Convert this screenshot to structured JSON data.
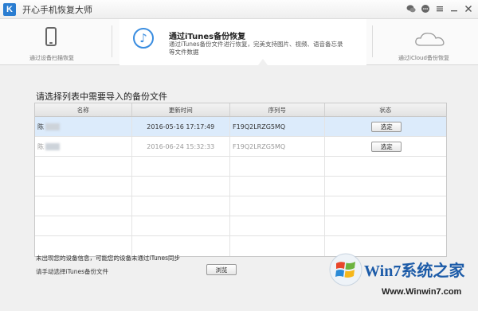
{
  "app": {
    "logo_letter": "K",
    "title": "开心手机恢复大师"
  },
  "title_icons": [
    "wechat-icon",
    "chat-icon",
    "menu-icon",
    "minimize-icon",
    "close-icon"
  ],
  "modes": {
    "scan": {
      "label": "通过设备扫描恢复",
      "icon": "phone-icon"
    },
    "itunes": {
      "title": "通过iTunes备份恢复",
      "desc": "通过iTunes备份文件进行恢复，完美支持图片、视频、语音备忘录等文件数据",
      "icon": "music-note-icon",
      "active": true
    },
    "icloud": {
      "label": "通过iCloud备份恢复",
      "icon": "cloud-icon"
    }
  },
  "main": {
    "heading": "请选择列表中需要导入的备份文件",
    "columns": [
      "名称",
      "更新时间",
      "序列号",
      "状态"
    ],
    "rows": [
      {
        "name": "陈",
        "time": "2016-05-16 17:17:49",
        "serial": "F19Q2LRZG5MQ",
        "action": "选定",
        "selected": true
      },
      {
        "name": "陈",
        "time": "2016-06-24 15:32:33",
        "serial": "F19Q2LRZG5MQ",
        "action": "选定",
        "selected": false
      }
    ],
    "note_missing": "未出现您的设备信息，可能您的设备未通过iTunes同步",
    "note_manual": "请手动选择iTunes备份文件",
    "browse_label": "浏览"
  },
  "watermark": {
    "text": "Win7系统之家",
    "url": "Www.Winwin7.com"
  },
  "colors": {
    "accent": "#3a8de0",
    "selected_row": "#dcebfb",
    "watermark_text": "#1c5ba8"
  }
}
